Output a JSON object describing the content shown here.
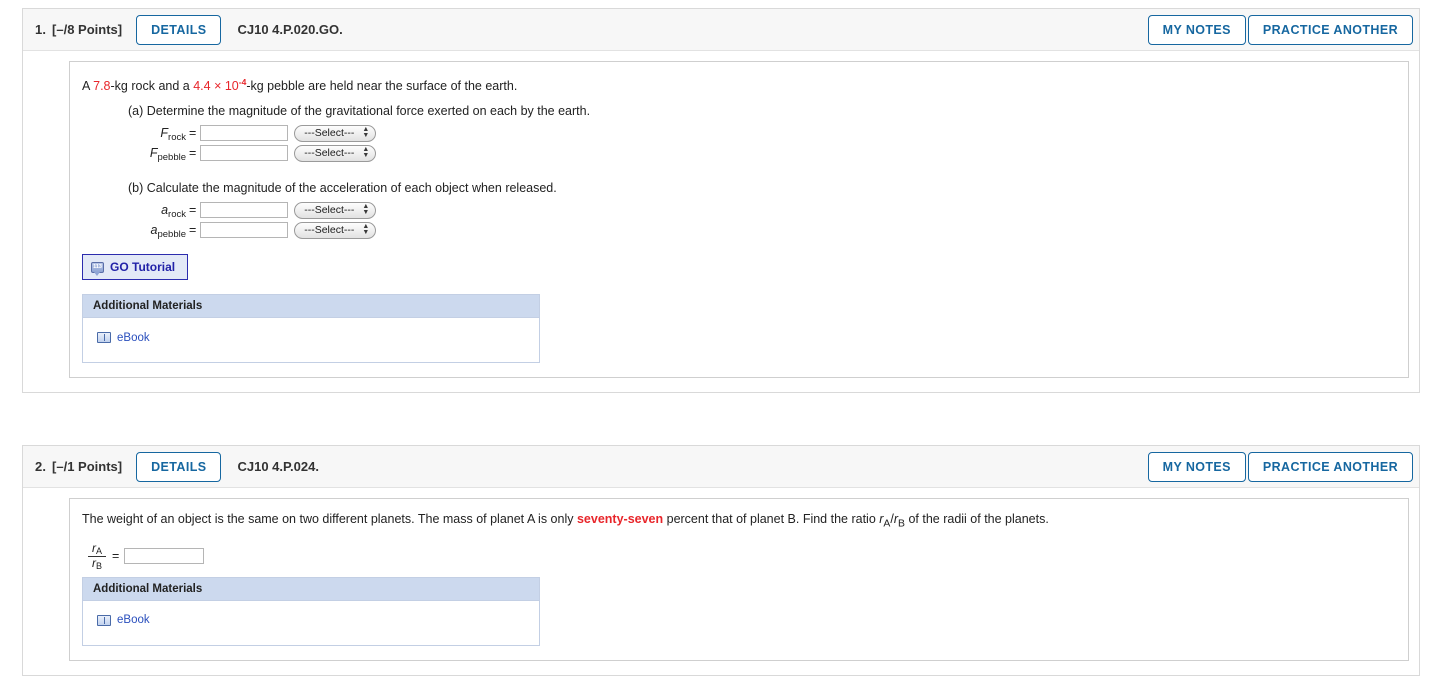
{
  "questions": [
    {
      "number": "1.",
      "points": "[–/8 Points]",
      "details_label": "DETAILS",
      "tag": "CJ10 4.P.020.GO.",
      "my_notes_label": "MY NOTES",
      "practice_label": "PRACTICE ANOTHER",
      "prompt": {
        "seg1": "A ",
        "val1": "7.8",
        "seg2": "-kg rock and a ",
        "val2": "4.4",
        "times": " × ",
        "base": "10",
        "exponent": "-4",
        "seg3": "-kg pebble are held near the surface of the earth."
      },
      "part_a": "(a) Determine the magnitude of the gravitational force exerted on each by the earth.",
      "part_b": "(b) Calculate the magnitude of the acceleration of each object when released.",
      "rows_a": [
        {
          "symbol": "F",
          "sub": "rock",
          "eq": "=",
          "value": "",
          "select": "---Select---"
        },
        {
          "symbol": "F",
          "sub": "pebble",
          "eq": "=",
          "value": "",
          "select": "---Select---"
        }
      ],
      "rows_b": [
        {
          "symbol": "a",
          "sub": "rock",
          "eq": "=",
          "value": "",
          "select": "---Select---"
        },
        {
          "symbol": "a",
          "sub": "pebble",
          "eq": "=",
          "value": "",
          "select": "---Select---"
        }
      ],
      "go_tutorial_label": "GO Tutorial",
      "go_tutorial_icon_text": "113",
      "additional_materials_title": "Additional Materials",
      "ebook_label": "eBook"
    },
    {
      "number": "2.",
      "points": "[–/1 Points]",
      "details_label": "DETAILS",
      "tag": "CJ10 4.P.024.",
      "my_notes_label": "MY NOTES",
      "practice_label": "PRACTICE ANOTHER",
      "prompt": {
        "seg1": "The weight of an object is the same on two different planets. The mass of planet A is only ",
        "val1": "seventy-seven",
        "seg2": " percent that of planet B. Find the ratio ",
        "ratio_num": "r",
        "ratio_num_sub": "A",
        "ratio_slash": "/",
        "ratio_den": "r",
        "ratio_den_sub": "B",
        "seg3": " of the radii of the planets."
      },
      "fraction": {
        "num_symbol": "r",
        "num_sub": "A",
        "den_symbol": "r",
        "den_sub": "B",
        "eq": "=",
        "value": ""
      },
      "additional_materials_title": "Additional Materials",
      "ebook_label": "eBook"
    }
  ],
  "colors": {
    "accent_blue": "#1667a0",
    "red": "#e8262b",
    "tutorial_blue": "#2222a8",
    "link_blue": "#2a4fbd",
    "panel_header": "#ccd9ee"
  }
}
